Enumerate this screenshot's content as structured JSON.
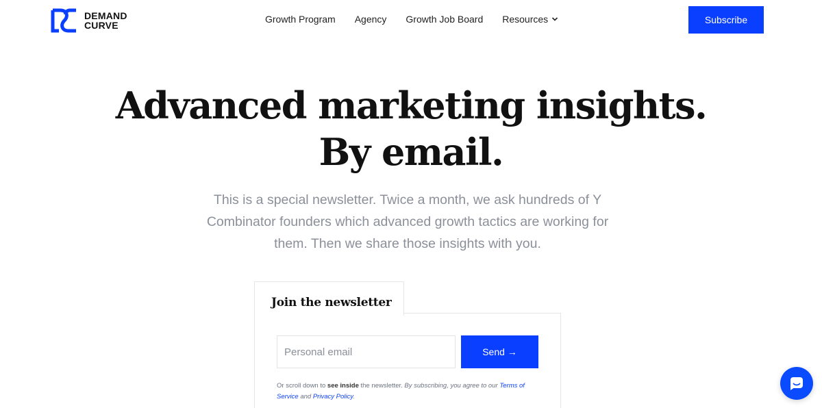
{
  "brand": {
    "line1": "DEMAND",
    "line2": "CURVE",
    "accent_color": "#0a3fff"
  },
  "nav": {
    "items": [
      {
        "label": "Growth Program"
      },
      {
        "label": "Agency"
      },
      {
        "label": "Growth Job Board"
      },
      {
        "label": "Resources"
      }
    ],
    "subscribe_label": "Subscribe"
  },
  "hero": {
    "title_line1": "Advanced marketing insights.",
    "title_line2": "By email.",
    "subtitle": "This is a special newsletter. Twice a month, we ask hundreds of Y Combinator founders which advanced growth tactics are working for them. Then we share those insights with you."
  },
  "newsletter": {
    "tab_label": "Join the newsletter",
    "email_placeholder": "Personal email",
    "email_value": "",
    "send_label": "Send →",
    "fine_print": {
      "part1": "Or scroll down to ",
      "bold": "see inside",
      "part2": " the newsletter. ",
      "italic": "By subscribing, you agree to our ",
      "terms_link": "Terms of Service",
      "and": " and ",
      "privacy_link": "Privacy Policy",
      "end": "."
    }
  },
  "chat": {
    "icon": "chat-bubble-icon"
  }
}
